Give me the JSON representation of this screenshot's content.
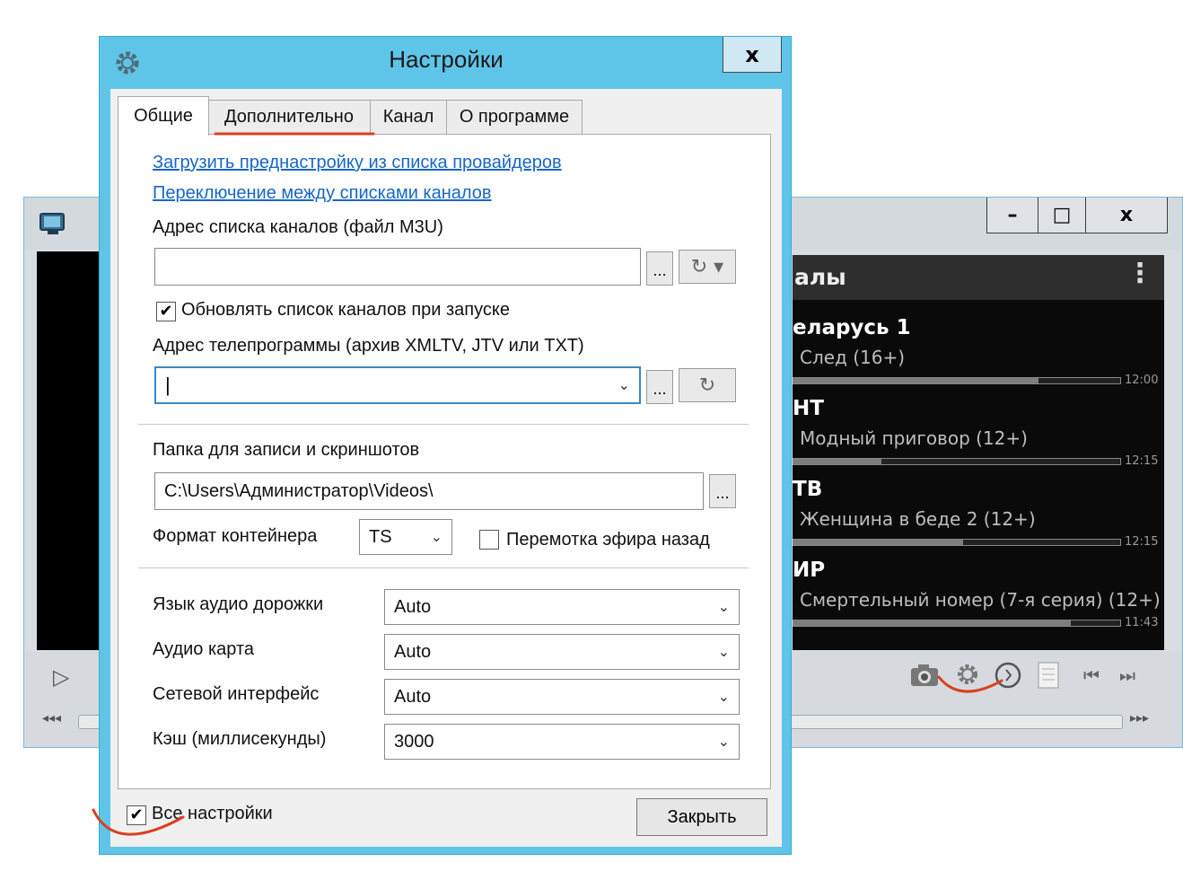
{
  "dialog": {
    "title": "Настройки",
    "close_glyph": "x",
    "tabs": [
      {
        "label": "Общие"
      },
      {
        "label": "Дополнительно"
      },
      {
        "label": "Канал"
      },
      {
        "label": "О программе"
      }
    ],
    "links": {
      "load_preset": "Загрузить преднастройку из списка провайдеров",
      "switch_lists": "Переключение между списками каналов"
    },
    "m3u": {
      "label": "Адрес списка каналов (файл M3U)",
      "value": "",
      "browse": "..."
    },
    "update_on_start": {
      "label": "Обновлять список каналов при запуске",
      "checked": true
    },
    "epg": {
      "label": "Адрес телепрограммы (архив XMLTV, JTV или TXT)",
      "value": "",
      "browse": "..."
    },
    "record_folder": {
      "label": "Папка для записи и скриншотов",
      "value": "C:\\Users\\Администратор\\Videos\\",
      "browse": "..."
    },
    "container": {
      "label": "Формат контейнера",
      "value": "TS"
    },
    "timeshift": {
      "label": "Перемотка эфира назад",
      "checked": false
    },
    "audio_lang": {
      "label": "Язык аудио дорожки",
      "value": "Auto"
    },
    "audio_card": {
      "label": "Аудио карта",
      "value": "Auto"
    },
    "net_iface": {
      "label": "Сетевой интерфейс",
      "value": "Auto"
    },
    "cache": {
      "label": "Кэш (миллисекунды)",
      "value": "3000"
    },
    "all_settings": {
      "label": "Все настройки",
      "checked": true
    },
    "close_button": "Закрыть"
  },
  "player": {
    "list_title": "алы",
    "window_buttons": {
      "minimize": "–",
      "maximize": "□",
      "close": "x"
    },
    "channels": [
      {
        "name": "еларусь 1",
        "program": "След (16+)",
        "time": "12:00",
        "progress": 0.75
      },
      {
        "name": "НТ",
        "program": "Модный приговор (12+)",
        "time": "12:15",
        "progress": 0.27
      },
      {
        "name": "ТВ",
        "program": "Женщина в беде 2 (12+)",
        "time": "12:15",
        "progress": 0.52
      },
      {
        "name": "ИР",
        "program": "Смертельный номер (7-я серия) (12+)",
        "time": "11:43",
        "progress": 0.85
      }
    ]
  },
  "colors": {
    "dialog_frame": "#5fc5e8",
    "link": "#1866c7",
    "annotation": "#d9401f"
  }
}
